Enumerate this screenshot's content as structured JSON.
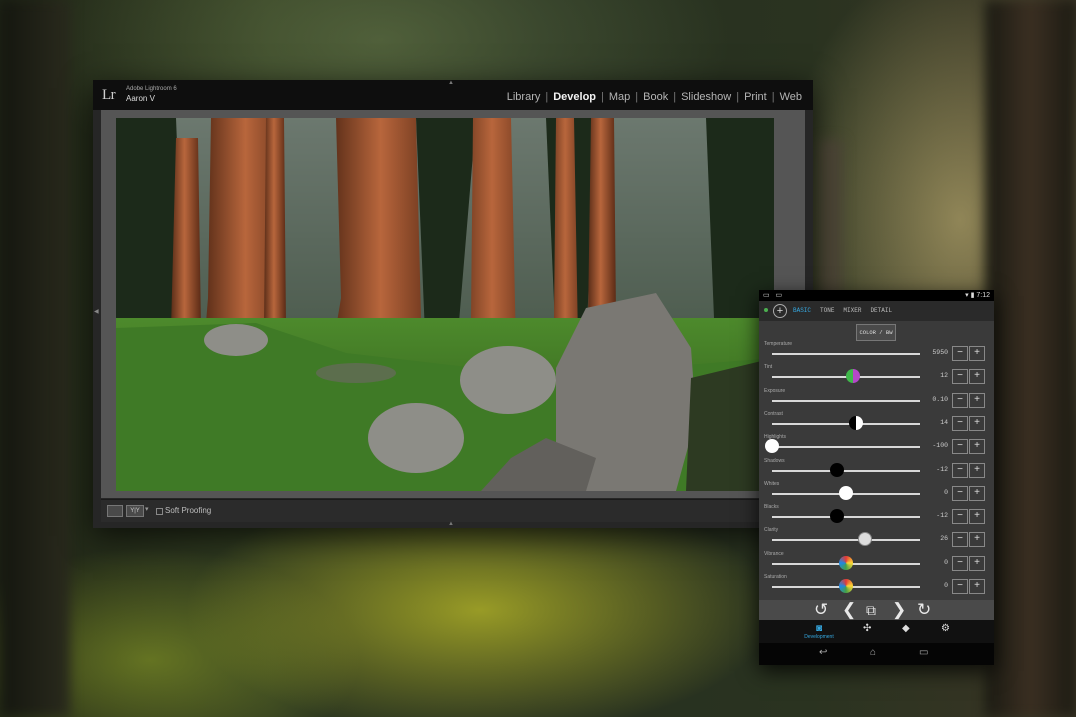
{
  "lightroom": {
    "logo": "Lr",
    "app_name": "Adobe Lightroom 6",
    "user": "Aaron V",
    "modules": [
      "Library",
      "Develop",
      "Map",
      "Book",
      "Slideshow",
      "Print",
      "Web"
    ],
    "active_module": "Develop",
    "toolbar": {
      "view_icon": "loupe-view-icon",
      "compare_label": "Y|Y",
      "soft_proofing_label": "Soft Proofing"
    }
  },
  "tablet": {
    "status_bar": {
      "left_icons": "▭ ▭",
      "right_text": "▾ ▮ 7:12"
    },
    "tabs": [
      "BASIC",
      "TONE",
      "MIXER",
      "DETAIL"
    ],
    "active_tab": "BASIC",
    "color_bw_label": "COLOR / BW",
    "sliders": [
      {
        "label": "Temperature",
        "value": "5950",
        "level": 0.46,
        "knob": "temperature"
      },
      {
        "label": "Tint",
        "value": "12",
        "level": 0.55,
        "knob": "tint"
      },
      {
        "label": "Exposure",
        "value": "0.10",
        "level": 0.51,
        "knob": "exposure"
      },
      {
        "label": "Contrast",
        "value": "14",
        "level": 0.57,
        "knob": "contrast"
      },
      {
        "label": "Highlights",
        "value": "-100",
        "level": 0.0,
        "knob": "highlights"
      },
      {
        "label": "Shadows",
        "value": "-12",
        "level": 0.44,
        "knob": "shadows"
      },
      {
        "label": "Whites",
        "value": "0",
        "level": 0.5,
        "knob": "whites"
      },
      {
        "label": "Blacks",
        "value": "-12",
        "level": 0.44,
        "knob": "blacks"
      },
      {
        "label": "Clarity",
        "value": "26",
        "level": 0.63,
        "knob": "clarity"
      },
      {
        "label": "Vibrance",
        "value": "0",
        "level": 0.5,
        "knob": "vibrance"
      },
      {
        "label": "Saturation",
        "value": "0",
        "level": 0.5,
        "knob": "saturation"
      }
    ],
    "minus_label": "−",
    "plus_label": "+",
    "actions": {
      "reset": "↺",
      "prev": "❮",
      "copy": "⧉",
      "next": "❯",
      "redo": "↻"
    },
    "bottom_nav": {
      "development_label": "Development"
    },
    "system_nav": {
      "back": "↩",
      "home": "⌂",
      "recents": "▭"
    }
  },
  "colors": {
    "accent": "#35a8e0",
    "lr_header": "#0e0e0e",
    "panel": "#3a3a3a"
  }
}
